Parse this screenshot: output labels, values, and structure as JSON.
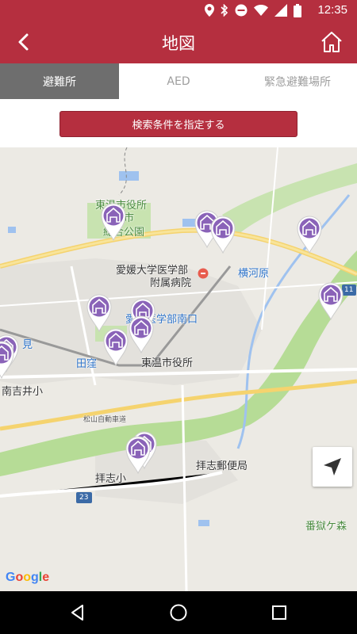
{
  "status": {
    "time": "12:35"
  },
  "appbar": {
    "title": "地図"
  },
  "tabs": [
    {
      "label": "避難所",
      "active": true
    },
    {
      "label": "AED",
      "active": false
    },
    {
      "label": "緊急避難場所",
      "active": false
    }
  ],
  "filter": {
    "button_label": "検索条件を指定する"
  },
  "map": {
    "labels": {
      "city_office_branch": "東温市役所",
      "city_park_line": "東温市",
      "park": "総合公園",
      "hospital_1": "愛媛大学医学部",
      "hospital_2": "附属病院",
      "station_yokogawara": "横河原",
      "station_aidai": "愛大医学部南口",
      "station_tasubo": "田窪",
      "station_mishima": "見奈良",
      "city_office": "東温市役所",
      "school_minamiyoshii": "南吉井小",
      "expressway": "松山自動車道",
      "school_haishi": "拝志小",
      "post_office": "拝志郵便局",
      "route_23": "23",
      "route_11": "11",
      "mountain": "番獄ケ森"
    },
    "attribution": "Google"
  },
  "colors": {
    "brand": "#b52f3f",
    "pin": "#8a63b8"
  }
}
